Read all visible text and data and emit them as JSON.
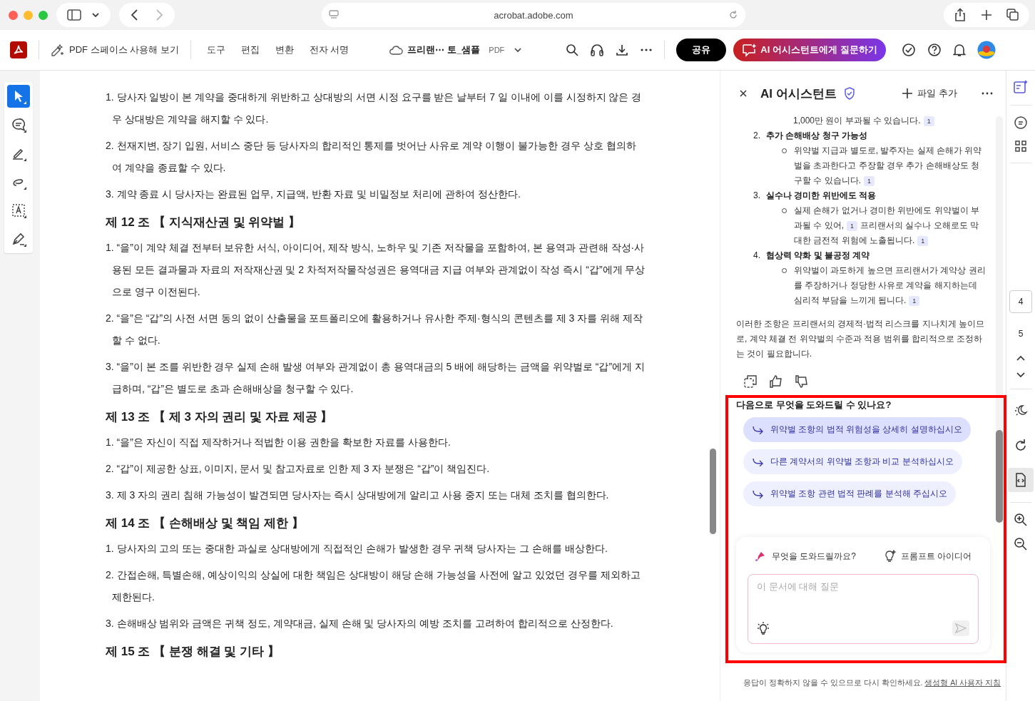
{
  "browser": {
    "url": "acrobat.adobe.com"
  },
  "toolbar": {
    "explore_label": "PDF 스페이스 사용해 보기",
    "menu": [
      "도구",
      "편집",
      "변환",
      "전자 서명"
    ],
    "file_name": "프리랜⋯ 토_샘플",
    "file_type": "PDF",
    "share": "공유",
    "ai_button": "AI 어시스턴트에게 질문하기"
  },
  "tools": [
    {
      "selected": true
    },
    {
      "selected": false
    },
    {
      "selected": false
    },
    {
      "selected": false
    },
    {
      "selected": false
    },
    {
      "selected": false
    }
  ],
  "document": {
    "sections": [
      {
        "clauses": [
          "1. 당사자 일방이 본 계약을 중대하게 위반하고 상대방의 서면 시정 요구를 받은 날부터 7 일 이내에 이를 시정하지 않은 경우 상대방은 계약을 해지할 수 있다.",
          "2. 천재지변, 장기 입원, 서비스 중단 등 당사자의 합리적인 통제를 벗어난 사유로 계약 이행이 불가능한 경우 상호 협의하여 계약을 종료할 수 있다.",
          "3. 계약 종료 시 당사자는 완료된 업무, 지급액, 반환 자료 및 비밀정보 처리에 관하여 정산한다."
        ]
      },
      {
        "heading": "제 12 조 【 지식재산권 및 위약벌 】",
        "clauses": [
          "1. “을”이 계약 체결 전부터 보유한 서식, 아이디어, 제작 방식, 노하우 및 기존 저작물을 포함하여, 본 용역과 관련해 작성·사용된 모든 결과물과 자료의 저작재산권 및 2 차적저작물작성권은 용역대금 지급 여부와 관계없이 작성 즉시 “갑”에게 무상으로 영구 이전된다.",
          "2. “을”은 “갑”의 사전 서면 동의 없이 산출물을 포트폴리오에 활용하거나 유사한 주제·형식의 콘텐츠를 제 3 자를 위해 제작할 수 없다.",
          "3. “을”이 본 조를 위반한 경우 실제 손해 발생 여부와 관계없이 총 용역대금의 5 배에 해당하는 금액을 위약벌로 “갑”에게 지급하며, “갑”은 별도로 초과 손해배상을 청구할 수 있다."
        ]
      },
      {
        "heading": "제 13 조 【 제 3 자의 권리 및 자료 제공 】",
        "clauses": [
          "1. “을”은 자신이 직접 제작하거나 적법한 이용 권한을 확보한 자료를 사용한다.",
          "2. “갑”이 제공한 상표, 이미지, 문서 및 참고자료로 인한 제 3 자 분쟁은 “갑”이 책임진다.",
          "3. 제 3 자의 권리 침해 가능성이 발견되면 당사자는 즉시 상대방에게 알리고 사용 중지 또는 대체 조치를 협의한다."
        ]
      },
      {
        "heading": "제 14 조 【 손해배상 및 책임 제한 】",
        "clauses": [
          "1. 당사자의 고의 또는 중대한 과실로 상대방에게 직접적인 손해가 발생한 경우 귀책 당사자는 그 손해를 배상한다.",
          "2. 간접손해, 특별손해, 예상이익의 상실에 대한 책임은 상대방이 해당 손해 가능성을 사전에 알고 있었던 경우를 제외하고 제한된다.",
          "3. 손해배상 범위와 금액은 귀책 정도, 계약대금, 실제 손해 및 당사자의 예방 조치를 고려하여 합리적으로 산정한다."
        ]
      },
      {
        "heading": "제 15 조 【 분쟁 해결 및 기타 】"
      }
    ]
  },
  "assistant": {
    "title": "AI 어시스턴트",
    "add_file": "파일 추가",
    "top_line": [
      {
        "kind": "text",
        "text": "1,000만 원이 부과될 수 있습니다."
      },
      {
        "kind": "cite",
        "text": "1"
      }
    ],
    "items": [
      {
        "number": "2.",
        "title": "추가 손해배상 청구 가능성",
        "bullet": [
          {
            "kind": "text",
            "text": "위약벌 지급과 별도로, 발주자는 실제 손해가 위약벌을 초과한다고 주장할 경우 추가 손해배상도 청구할 수 있습니다."
          },
          {
            "kind": "cite",
            "text": "1"
          }
        ]
      },
      {
        "number": "3.",
        "title": "실수나 경미한 위반에도 적용",
        "bullet": [
          {
            "kind": "text",
            "text": "실제 손해가 없거나 경미한 위반에도 위약벌이 부과될 수 있어,"
          },
          {
            "kind": "cite",
            "text": "1"
          },
          {
            "kind": "text",
            "text": "프리랜서의 실수나 오해로도 막대한 금전적 위험에 노출됩니다."
          },
          {
            "kind": "cite",
            "text": "1"
          }
        ]
      },
      {
        "number": "4.",
        "title": "협상력 약화 및 불공정 계약",
        "bullet": [
          {
            "kind": "text",
            "text": "위약벌이 과도하게 높으면 프리랜서가 계약상 권리를 주장하거나 정당한 사유로 계약을 해지하는데 심리적 부담을 느끼게 됩니다."
          },
          {
            "kind": "cite",
            "text": "1"
          }
        ]
      }
    ],
    "conclusion": "이러한 조항은 프리랜서의 경제적·법적 리스크를 지나치게 높이므로, 계약 체결 전 위약벌의 수준과 적용 범위를 합리적으로 조정하는 것이 필요합니다.",
    "next_heading": "다음으로 무엇을 도와드릴 수 있나요?",
    "suggestions": [
      {
        "text": "위약벌 조항의 법적 위험성을 상세히 설명하십시오",
        "selected": true
      },
      {
        "text": "다른 계약서의 위약벌 조항과 비교 분석하십시오",
        "selected": false
      },
      {
        "text": "위약벌 조항 관련 법적 판례를 분석해 주십시오",
        "selected": false
      }
    ],
    "composer": {
      "label": "무엇을 도와드릴까요?",
      "ideas": "프롬프트 아이디어",
      "placeholder": "이 문서에 대해 질문"
    },
    "disclaimer": "응답이 정확하지 않을 수 있으므로 다시 확인하세요.",
    "guidelines_link": "생성형 AI 사용자 지침"
  },
  "page_nav": [
    {
      "label": "4",
      "selected": true
    },
    {
      "label": "5",
      "selected": false
    }
  ],
  "rail_tools": [
    {
      "selected": false
    },
    {
      "selected": false
    },
    {
      "selected": true
    }
  ]
}
